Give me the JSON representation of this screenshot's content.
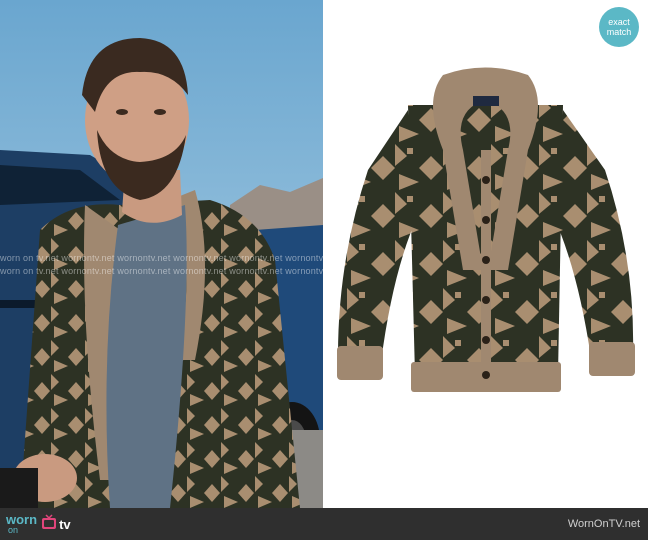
{
  "badge": {
    "line1": "exact",
    "line2": "match"
  },
  "watermark": {
    "text": "worn on tv.net  wornontv.net  wornontv.net  wornontv.net  wornontv.net  wornontv.net"
  },
  "footer": {
    "logo_worn": "worn",
    "logo_on": "on",
    "logo_tv": "tv",
    "site_label": "WornOnTV.net"
  },
  "colors": {
    "brand_teal": "#5bb8c6",
    "footer_bg": "#2f2f2f",
    "cardigan_dark": "#2d3224",
    "cardigan_tan": "#a98e70"
  },
  "icons": [
    "tv-icon"
  ]
}
